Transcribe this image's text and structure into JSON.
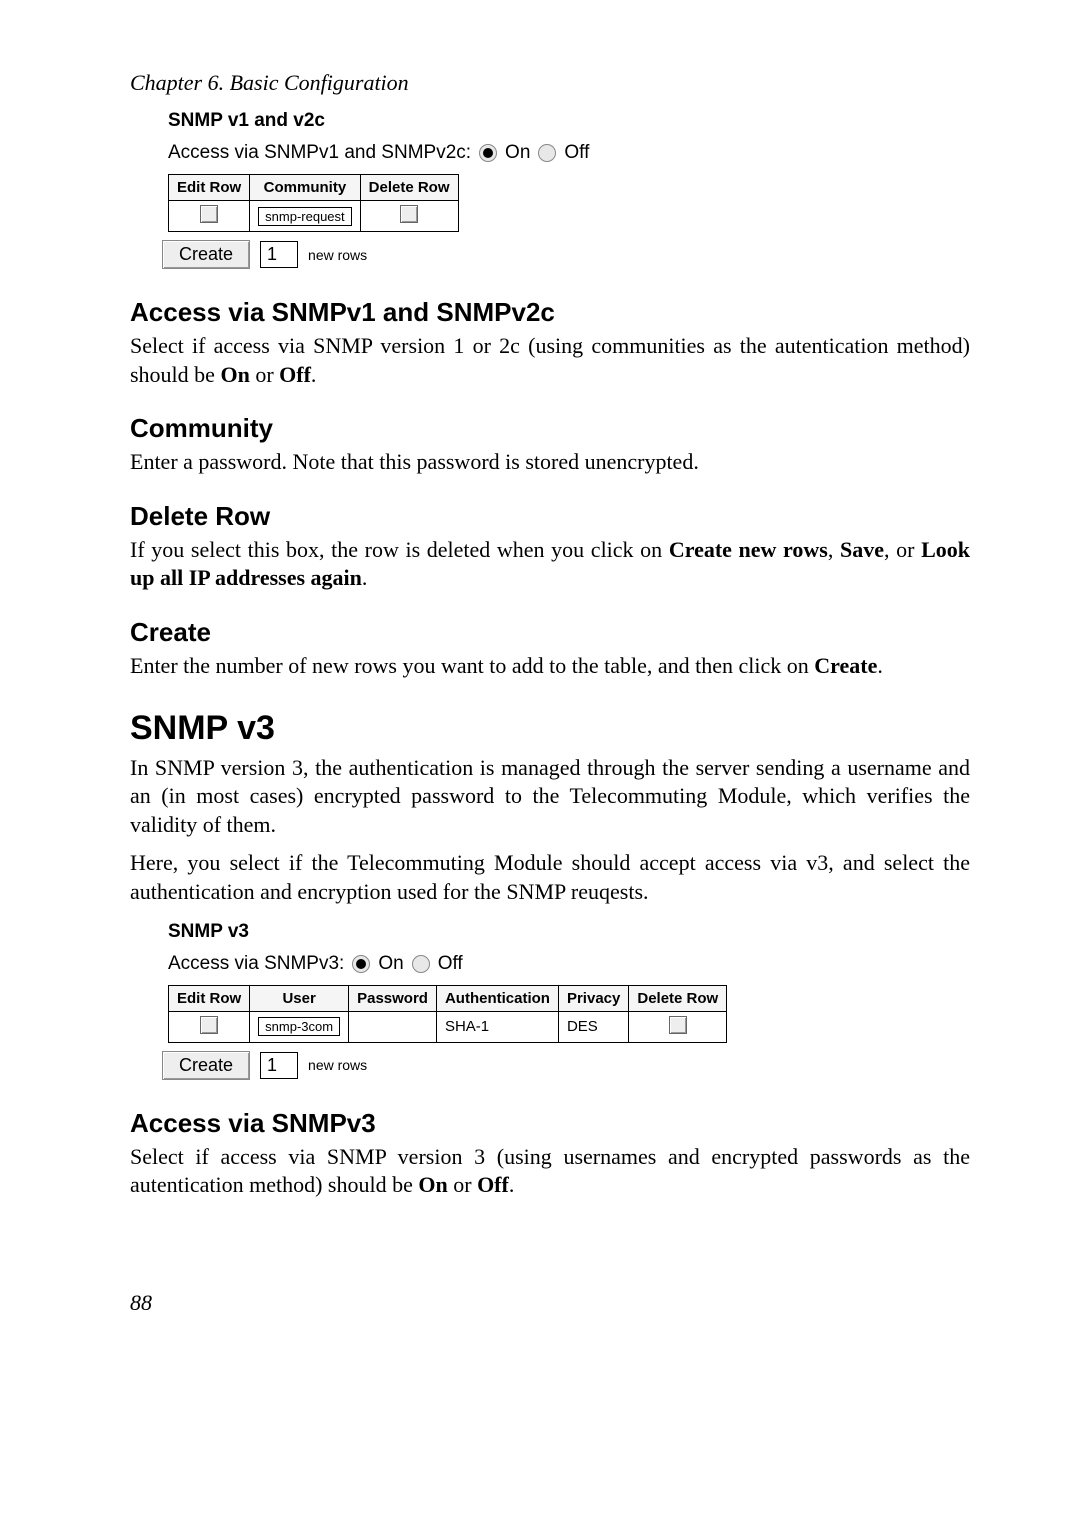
{
  "chapter": "Chapter 6. Basic Configuration",
  "screenshot1": {
    "title": "SNMP v1 and v2c",
    "access_label": "Access via SNMPv1 and SNMPv2c:",
    "on": "On",
    "off": "Off",
    "headers": [
      "Edit Row",
      "Community",
      "Delete Row"
    ],
    "row": {
      "community": "snmp-request"
    },
    "create_label": "Create",
    "create_count": "1",
    "new_rows_label": "new rows"
  },
  "sec1": {
    "h": "Access via SNMPv1 and SNMPv2c",
    "p_a": "Select if access via SNMP version 1 or 2c (using communities as the autentication method) should be ",
    "on": "On",
    "or": " or ",
    "off": "Off",
    "end": "."
  },
  "sec2": {
    "h": "Community",
    "p": "Enter a password. Note that this password is stored unencrypted."
  },
  "sec3": {
    "h": "Delete Row",
    "p_a": "If you select this box, the row is deleted when you click on ",
    "b1": "Create new rows",
    "c1": ", ",
    "b2": "Save",
    "c2": ", or ",
    "b3": "Look up all IP addresses again",
    "end": "."
  },
  "sec4": {
    "h": "Create",
    "p_a": "Enter the number of new rows you want to add to the table, and then click on ",
    "b1": "Create",
    "end": "."
  },
  "snmpv3": {
    "h": "SNMP v3",
    "p1": "In SNMP version 3, the authentication is managed through the server sending a username and an (in most cases) encrypted password to the Telecommuting Module, which verifies the validity of them.",
    "p2": "Here, you select if the Telecommuting Module should accept access via v3, and select the authentication and encryption used for the SNMP reuqests."
  },
  "screenshot2": {
    "title": "SNMP v3",
    "access_label": "Access via SNMPv3:",
    "on": "On",
    "off": "Off",
    "headers": [
      "Edit Row",
      "User",
      "Password",
      "Authentication",
      "Privacy",
      "Delete Row"
    ],
    "row": {
      "user": "snmp-3com",
      "password": "",
      "auth": "SHA-1",
      "privacy": "DES"
    },
    "create_label": "Create",
    "create_count": "1",
    "new_rows_label": "new rows"
  },
  "sec5": {
    "h": "Access via SNMPv3",
    "p_a": "Select if access via SNMP version 3 (using usernames and encrypted passwords as the autentication method) should be ",
    "on": "On",
    "or": " or ",
    "off": "Off",
    "end": "."
  },
  "page_number": "88"
}
